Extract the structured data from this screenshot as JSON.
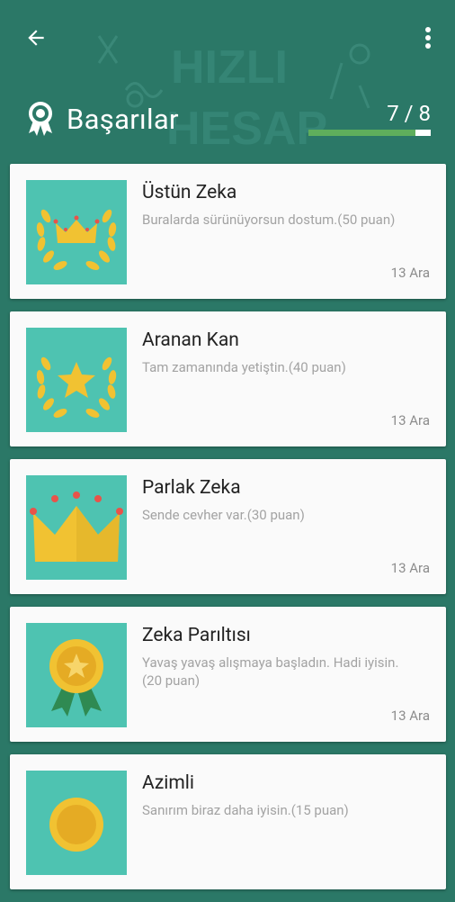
{
  "header": {
    "title": "Başarılar",
    "progress_text": "7 / 8",
    "progress_fraction": 0.875,
    "back_icon": "arrow-back-icon",
    "menu_icon": "more-vert-icon"
  },
  "background": {
    "watermark_line1": "HIZLI",
    "watermark_line2": "HESAP"
  },
  "colors": {
    "background": "#2b7867",
    "card": "#fafafa",
    "thumb": "#4ec3b1",
    "gold": "#f1c232",
    "progress": "#5fae5c"
  },
  "achievements": [
    {
      "name": "Üstün Zeka",
      "description": "Buralarda sürünüyorsun dostum.(50 puan)",
      "date": "13 Ara",
      "icon": "crown-wreath-icon"
    },
    {
      "name": "Aranan Kan",
      "description": "Tam zamanında yetiştin.(40 puan)",
      "date": "13 Ara",
      "icon": "star-wreath-icon"
    },
    {
      "name": "Parlak Zeka",
      "description": "Sende cevher var.(30 puan)",
      "date": "13 Ara",
      "icon": "crown-icon"
    },
    {
      "name": "Zeka Parıltısı",
      "description": "Yavaş yavaş alışmaya başladın. Hadi iyisin.(20 puan)",
      "date": "13 Ara",
      "icon": "medal-ribbon-icon"
    },
    {
      "name": "Azimli",
      "description": "Sanırım biraz daha iyisin.(15 puan)",
      "date": "",
      "icon": "gold-medal-icon"
    }
  ]
}
